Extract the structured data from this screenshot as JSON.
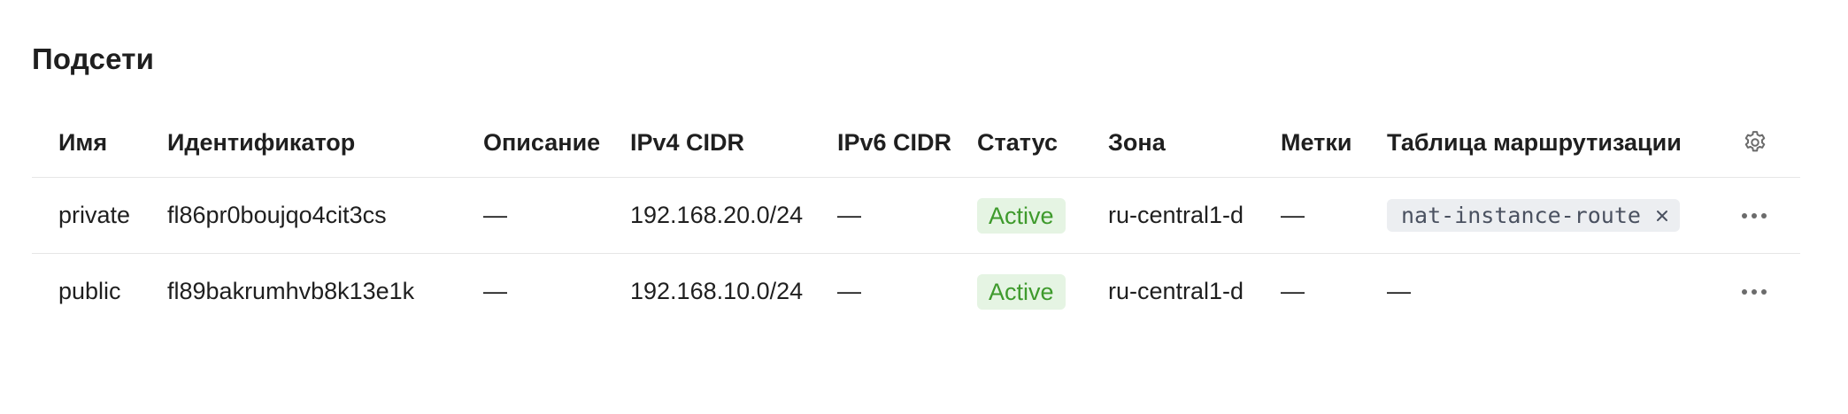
{
  "page_title": "Подсети",
  "columns": {
    "name": "Имя",
    "id": "Идентификатор",
    "description": "Описание",
    "ipv4": "IPv4 CIDR",
    "ipv6": "IPv6 CIDR",
    "status": "Статус",
    "zone": "Зона",
    "labels": "Метки",
    "route_table": "Таблица маршрутизации"
  },
  "header_icons": {
    "settings": "gear-icon"
  },
  "rows": [
    {
      "name": "private",
      "id": "fl86pr0boujqo4cit3cs",
      "description": "—",
      "ipv4": "192.168.20.0/24",
      "ipv6": "—",
      "status": "Active",
      "zone": "ru-central1-d",
      "labels": "—",
      "route_table": "nat-instance-route",
      "route_table_removable": true
    },
    {
      "name": "public",
      "id": "fl89bakrumhvb8k13e1k",
      "description": "—",
      "ipv4": "192.168.10.0/24",
      "ipv6": "—",
      "status": "Active",
      "zone": "ru-central1-d",
      "labels": "—",
      "route_table": "—",
      "route_table_removable": false
    }
  ],
  "colors": {
    "status_active_bg": "#e5f4e3",
    "status_active_text": "#3e9a2c",
    "chip_bg": "#eceef1"
  }
}
